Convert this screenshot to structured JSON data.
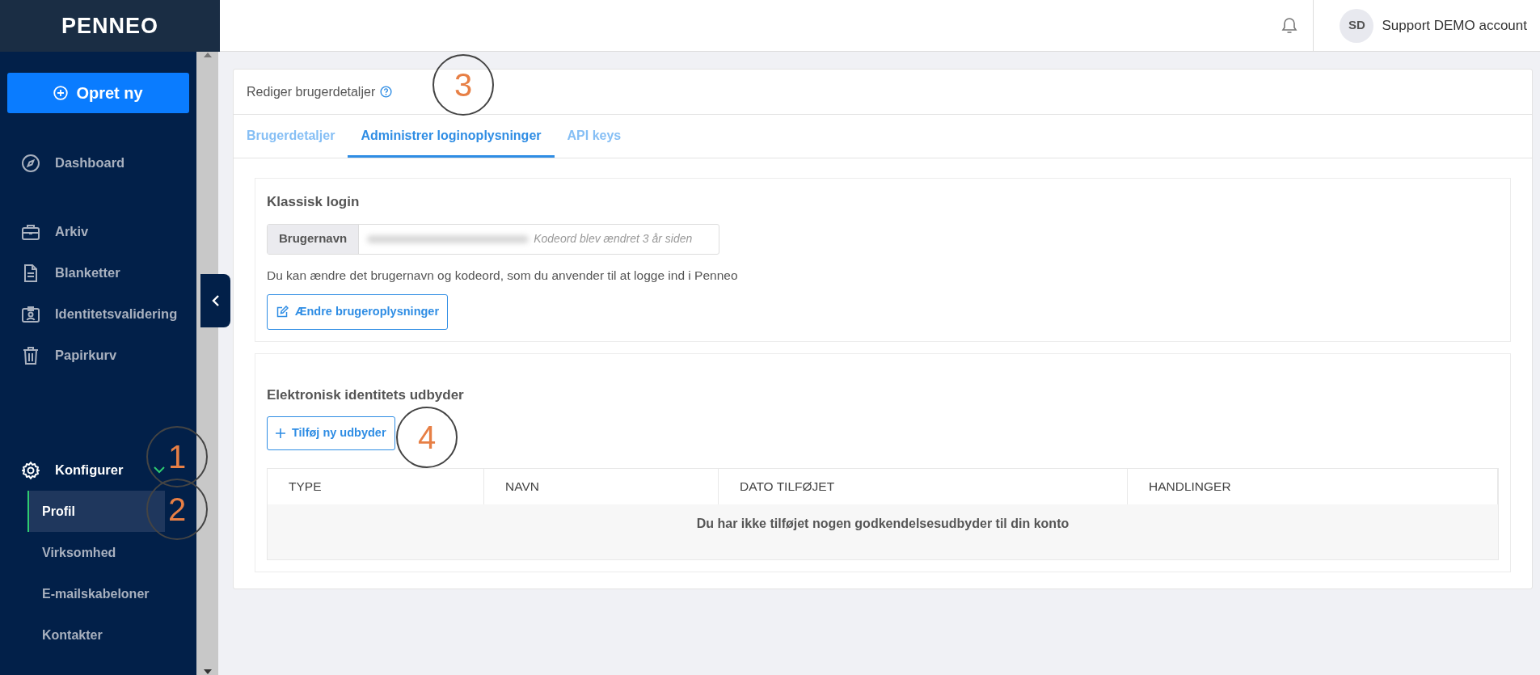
{
  "logo": "PENNEO",
  "header": {
    "user": {
      "initials": "SD",
      "name": "Support DEMO account"
    }
  },
  "sidebar": {
    "create_button": "Opret ny",
    "groups": [
      [
        {
          "label": "Dashboard"
        }
      ],
      [
        {
          "label": "Arkiv"
        },
        {
          "label": "Blanketter"
        },
        {
          "label": "Identitetsvalidering"
        },
        {
          "label": "Papirkurv"
        }
      ],
      [
        {
          "label": "Konfigurer",
          "expanded": true,
          "children": [
            {
              "label": "Profil",
              "selected": true
            },
            {
              "label": "Virksomhed",
              "selected": false
            },
            {
              "label": "E-mailskabeloner",
              "selected": false
            },
            {
              "label": "Kontakter",
              "selected": false
            }
          ]
        }
      ]
    ]
  },
  "card": {
    "title": "Rediger brugerdetaljer",
    "tabs": [
      {
        "label": "Brugerdetaljer",
        "selected": false
      },
      {
        "label": "Administrer loginoplysninger",
        "selected": true
      },
      {
        "label": "API keys",
        "selected": false
      }
    ],
    "classic_login": {
      "title": "Klassisk login",
      "username_label": "Brugernavn",
      "password_note": "Kodeord blev ændret 3 år siden",
      "description": "Du kan ændre det brugernavn og kodeord, som du anvender til at logge ind i Penneo",
      "button": "Ændre brugeroplysninger"
    },
    "identity_providers": {
      "title": "Elektronisk identitets udbyder",
      "button": "Tilføj ny udbyder",
      "table": {
        "columns": [
          "TYPE",
          "NAVN",
          "DATO TILFØJET",
          "HANDLINGER"
        ],
        "empty_message": "Du har ikke tilføjet nogen godkendelsesudbyder til din konto"
      }
    }
  },
  "annotations": [
    {
      "label": "1"
    },
    {
      "label": "2"
    },
    {
      "label": "3"
    },
    {
      "label": "4"
    }
  ]
}
